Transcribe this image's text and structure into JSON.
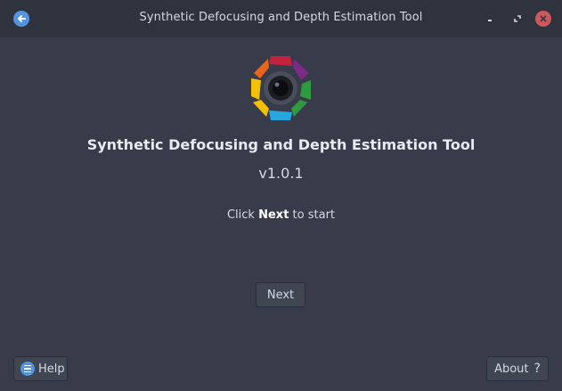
{
  "window": {
    "title": "Synthetic Defocusing and Depth Estimation Tool"
  },
  "titlebar_icons": {
    "back": "back-arrow-icon",
    "minimize": "minimize-icon",
    "maximize": "maximize-icon",
    "close": "close-icon"
  },
  "main": {
    "app_name": "Synthetic Defocusing and Depth Estimation Tool",
    "version": "v1.0.1",
    "hint_prefix": "Click",
    "hint_bold": "Next",
    "hint_suffix": "to start"
  },
  "buttons": {
    "next_label": "Next",
    "help_label": "Help",
    "about_label": "About",
    "about_icon_glyph": "?"
  },
  "colors": {
    "accent": "#5294e2",
    "close": "#cc575d",
    "logo": [
      "#c3213c",
      "#7b2a86",
      "#2e9b3e",
      "#27a7e1",
      "#f3c100",
      "#e9651c"
    ]
  }
}
